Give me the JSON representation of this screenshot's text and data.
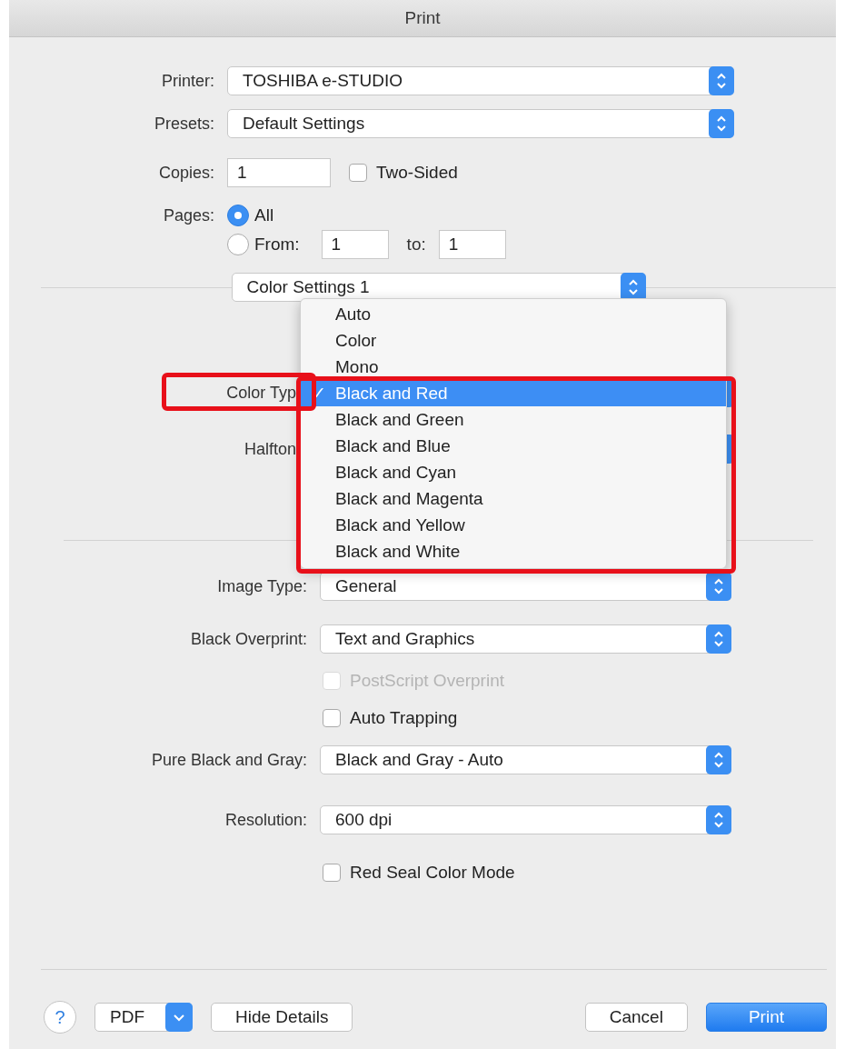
{
  "window": {
    "title": "Print"
  },
  "printer": {
    "label": "Printer:",
    "value": "TOSHIBA e-STUDIO"
  },
  "presets": {
    "label": "Presets:",
    "value": "Default Settings"
  },
  "copies": {
    "label": "Copies:",
    "value": "1"
  },
  "two_sided": {
    "label": "Two-Sided",
    "checked": false
  },
  "pages": {
    "label": "Pages:",
    "options": [
      {
        "label": "All",
        "selected": true
      },
      {
        "label": "From:",
        "selected": false
      }
    ],
    "from": "1",
    "to_label": "to:",
    "to": "1"
  },
  "section_popup": {
    "value": "Color Settings 1"
  },
  "hidden_settings": [
    {
      "label": "Color Typ"
    },
    {
      "label": "Halfton"
    }
  ],
  "color_type_menu": {
    "check": "✓",
    "items": [
      {
        "label": "Auto",
        "selected": false
      },
      {
        "label": "Color",
        "selected": false
      },
      {
        "label": "Mono",
        "selected": false
      },
      {
        "label": "Black and Red",
        "selected": true
      },
      {
        "label": "Black and Green",
        "selected": false
      },
      {
        "label": "Black and Blue",
        "selected": false
      },
      {
        "label": "Black and Cyan",
        "selected": false
      },
      {
        "label": "Black and Magenta",
        "selected": false
      },
      {
        "label": "Black and Yellow",
        "selected": false
      },
      {
        "label": "Black and White",
        "selected": false
      }
    ]
  },
  "settings": [
    {
      "kind": "popup",
      "label": "Image Type:",
      "value": "General"
    },
    {
      "kind": "popup",
      "label": "Black Overprint:",
      "value": "Text and Graphics"
    },
    {
      "kind": "checkbox",
      "label": "PostScript Overprint",
      "checked": false,
      "disabled": true
    },
    {
      "kind": "checkbox",
      "label": "Auto Trapping",
      "checked": false,
      "disabled": false
    },
    {
      "kind": "popup",
      "label": "Pure Black and Gray:",
      "value": "Black and Gray - Auto"
    },
    {
      "kind": "popup",
      "label": "Resolution:",
      "value": "600 dpi"
    },
    {
      "kind": "checkbox",
      "label": "Red Seal Color Mode",
      "checked": false,
      "disabled": false
    }
  ],
  "buttons": [
    {
      "kind": "help",
      "label": "?"
    },
    {
      "kind": "menu",
      "label": "PDF"
    },
    {
      "kind": "plain",
      "label": "Hide Details"
    },
    {
      "kind": "spacer"
    },
    {
      "kind": "plain",
      "label": "Cancel"
    },
    {
      "kind": "default",
      "label": "Print"
    }
  ]
}
